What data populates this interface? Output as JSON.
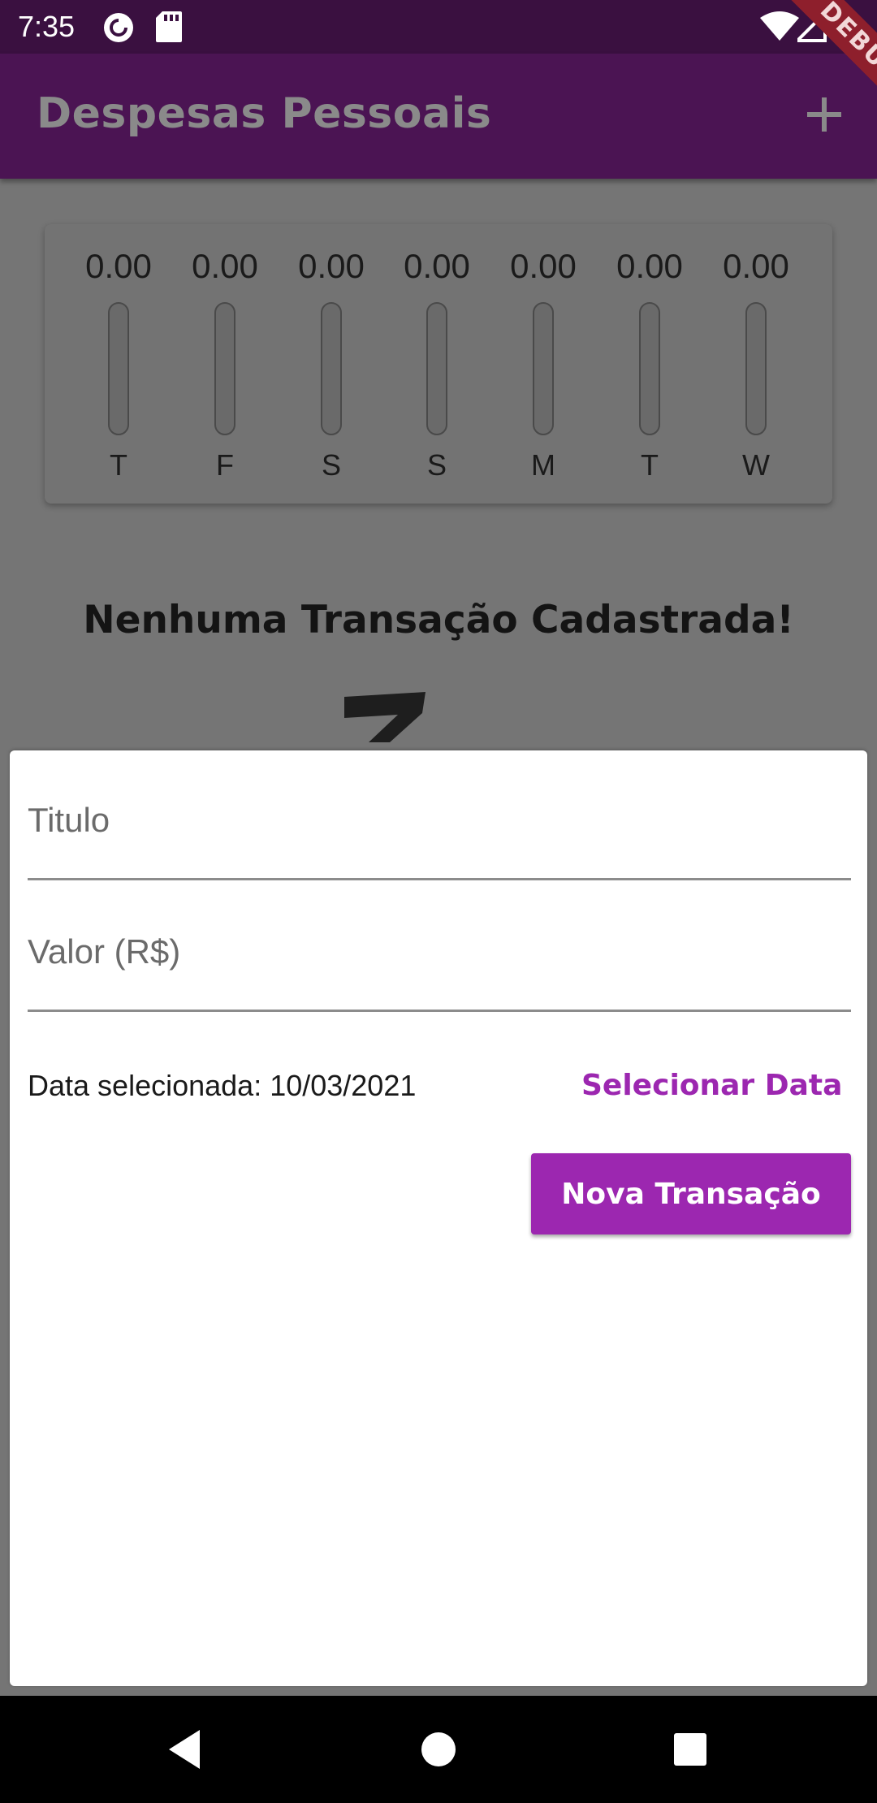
{
  "status_bar": {
    "time": "7:35",
    "left_icons": [
      "pocket-casts-icon",
      "sd-card-icon"
    ],
    "right_icons": [
      "wifi-icon",
      "signal-icon",
      "battery-icon"
    ]
  },
  "app_bar": {
    "title": "Despesas Pessoais",
    "action_icon": "add-icon"
  },
  "debug_banner": "DEBUG",
  "chart_data": {
    "type": "bar",
    "categories": [
      "T",
      "F",
      "S",
      "S",
      "M",
      "T",
      "W"
    ],
    "value_labels": [
      "0.00",
      "0.00",
      "0.00",
      "0.00",
      "0.00",
      "0.00",
      "0.00"
    ],
    "values": [
      0,
      0,
      0,
      0,
      0,
      0,
      0
    ],
    "fill_fraction": [
      0,
      0,
      0,
      0,
      0,
      0,
      0
    ],
    "bar_color": "#4b1453"
  },
  "empty_state": {
    "message": "Nenhuma Transação Cadastrada!"
  },
  "form": {
    "title_placeholder": "Titulo",
    "title_value": "",
    "value_placeholder": "Valor (R$)",
    "value_value": "",
    "date_label": "Data selecionada: 10/03/2021",
    "select_date_label": "Selecionar Data",
    "submit_label": "Nova Transação"
  },
  "colors": {
    "primary": "#9c27b0",
    "app_bar": "#4b1453",
    "status_bar": "#3a1040",
    "scrim": "#757575"
  },
  "nav_bar": {
    "buttons": [
      "back-icon",
      "home-icon",
      "recents-icon"
    ]
  }
}
